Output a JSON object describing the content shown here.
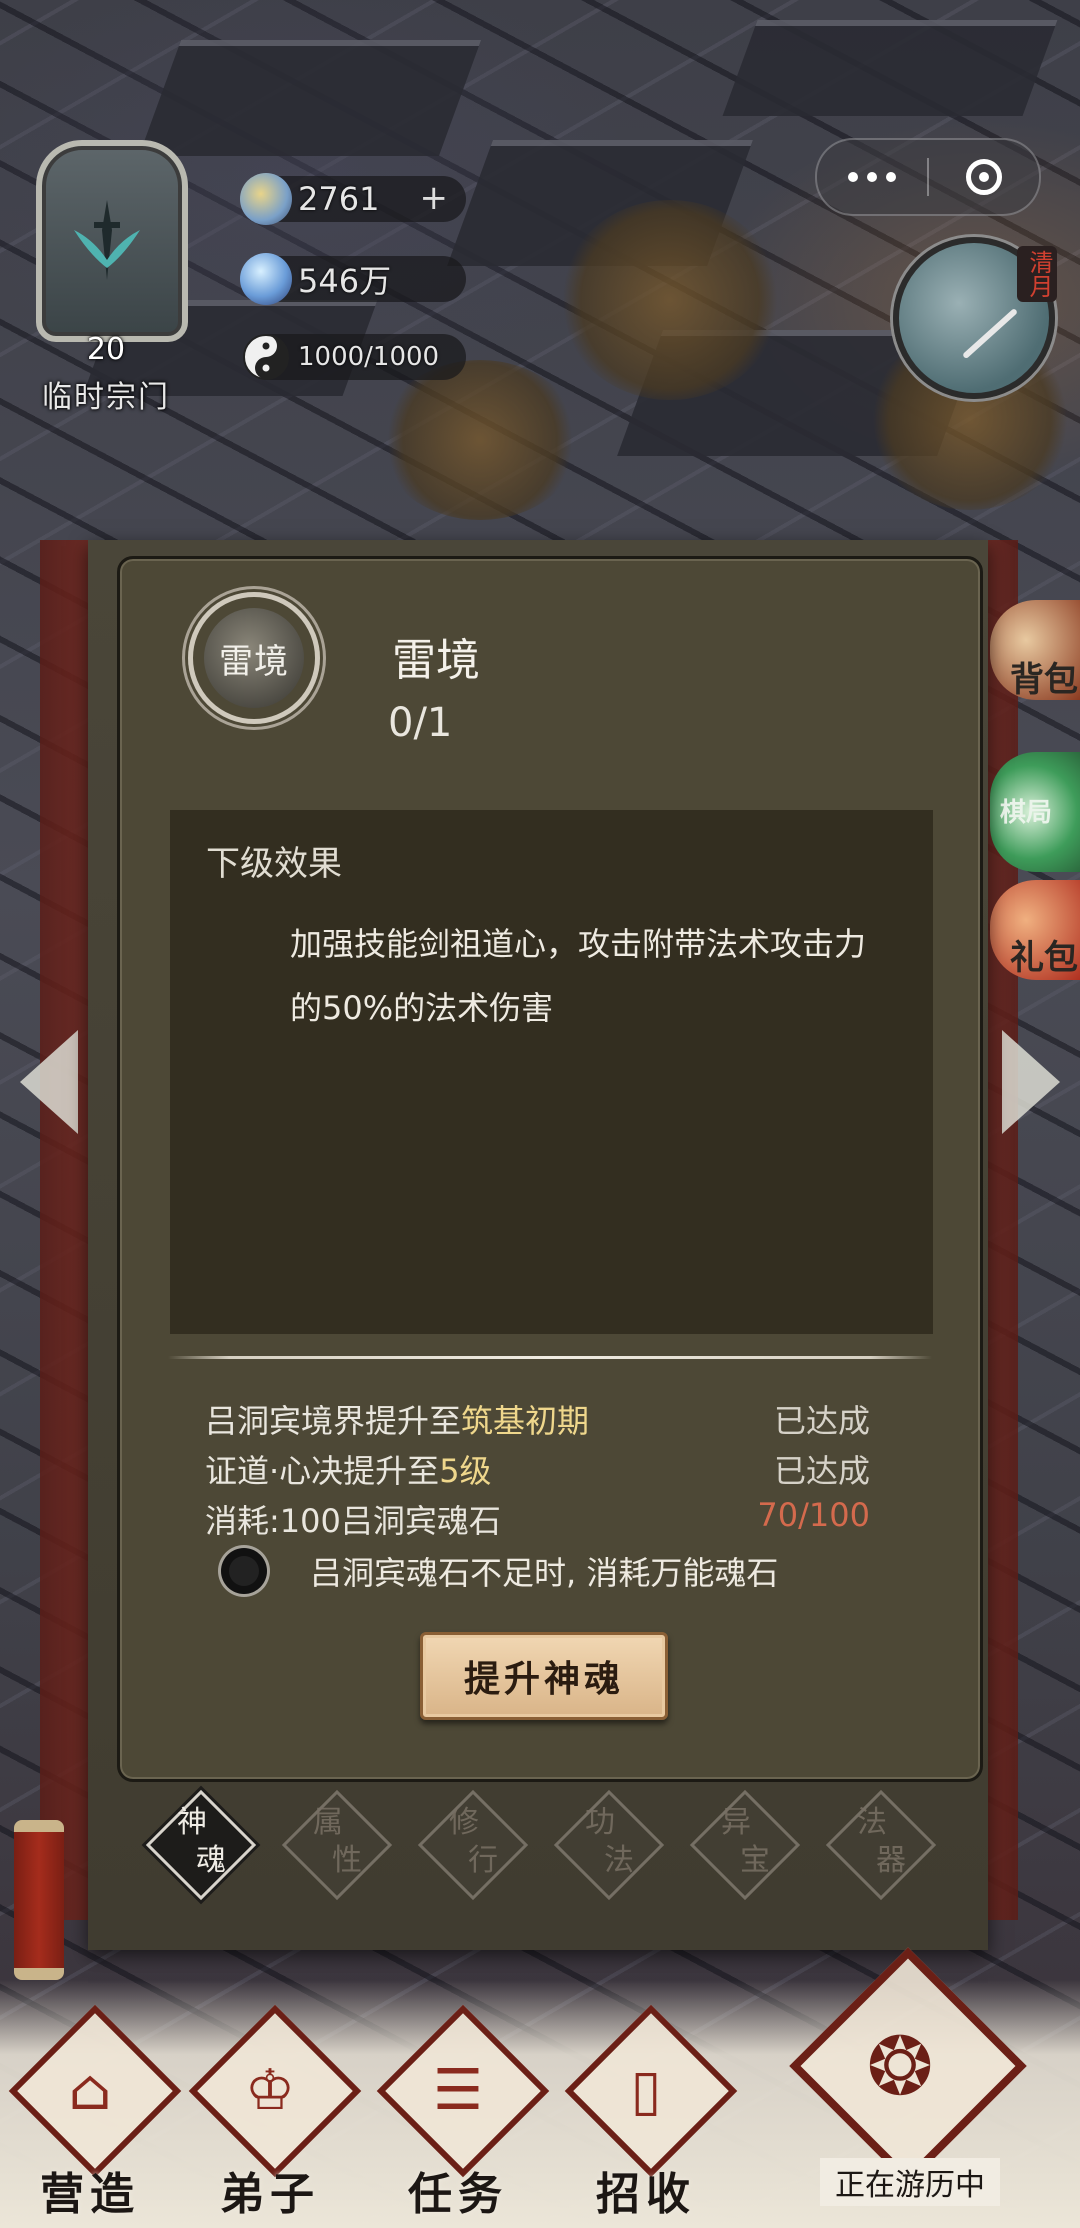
{
  "hud": {
    "sect_level": "20",
    "sect_name": "临时宗门",
    "resources": [
      {
        "icon": "spirit-stone-icon",
        "value": "2761",
        "has_add": true,
        "add_label": "+"
      },
      {
        "icon": "crystal-icon",
        "value": "546万"
      },
      {
        "icon": "yin-yang-icon",
        "value": "1000/1000"
      }
    ],
    "season": "清月"
  },
  "side": {
    "bag_label": "背包",
    "chess_label": "棋局",
    "gift_label": "礼包"
  },
  "panel": {
    "node_icon_text": "雷境",
    "node_title": "雷境",
    "node_progress": "0/1",
    "effect_heading": "下级效果",
    "effect_text": "加强技能剑祖道心，攻击附带法术攻击力的50%的法术伤害",
    "requirements": [
      {
        "prefix": "吕洞宾境界提升至",
        "highlight": "筑基初期",
        "status": "已达成",
        "status_color": "#d6d2c8"
      },
      {
        "prefix": "证道·心决提升至",
        "highlight": "5级",
        "status": "已达成",
        "status_color": "#d6d2c8"
      },
      {
        "prefix": "消耗:100吕洞宾魂石",
        "highlight": "",
        "status": "70/100",
        "status_color": "#d46a4d"
      }
    ],
    "option_label": "吕洞宾魂石不足时, 消耗万能魂石",
    "upgrade_button": "提升神魂"
  },
  "tabs": [
    {
      "a": "神",
      "b": "魂",
      "active": true
    },
    {
      "a": "属",
      "b": "性",
      "active": false
    },
    {
      "a": "修",
      "b": "行",
      "active": false
    },
    {
      "a": "功",
      "b": "法",
      "active": false
    },
    {
      "a": "异",
      "b": "宝",
      "active": false
    },
    {
      "a": "法",
      "b": "器",
      "active": false
    }
  ],
  "bottom_nav": [
    {
      "label": "营造",
      "glyph": "⌂"
    },
    {
      "label": "弟子",
      "glyph": "♔"
    },
    {
      "label": "任务",
      "glyph": "☰"
    },
    {
      "label": "招收",
      "glyph": "▯"
    }
  ],
  "travel_label": "正在游历中",
  "colors": {
    "panel_bg": "#4d4836",
    "effect_bg": "#332e20",
    "highlight": "#efd78c",
    "shortage_red": "#d46a4d",
    "button_bg": "#e4c49b"
  }
}
